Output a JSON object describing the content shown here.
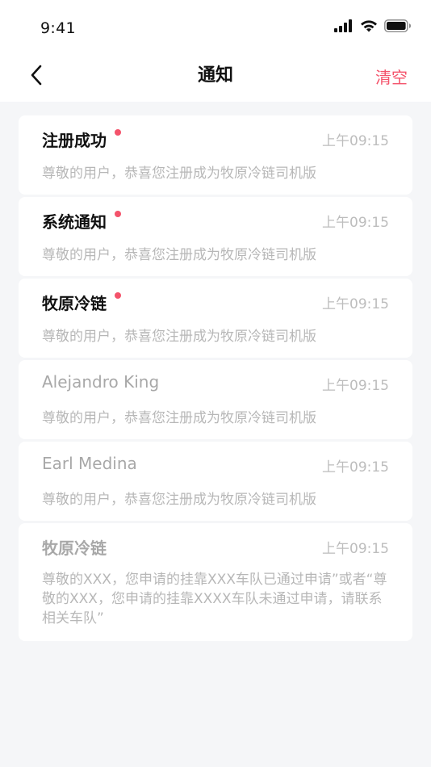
{
  "status_bar": {
    "time": "9:41",
    "icons": [
      "signal-icon",
      "wifi-icon",
      "battery-icon"
    ]
  },
  "nav": {
    "title": "通知",
    "action_label": "清空"
  },
  "notifications": [
    {
      "title": "注册成功",
      "time": "上午09:15",
      "body": "尊敬的用户，恭喜您注册成为牧原冷链司机版",
      "unread": true
    },
    {
      "title": "系统通知",
      "time": "上午09:15",
      "body": "尊敬的用户，恭喜您注册成为牧原冷链司机版",
      "unread": true
    },
    {
      "title": "牧原冷链",
      "time": "上午09:15",
      "body": "尊敬的用户，恭喜您注册成为牧原冷链司机版",
      "unread": true
    },
    {
      "title": "Alejandro King",
      "time": "上午09:15",
      "body": "尊敬的用户，恭喜您注册成为牧原冷链司机版",
      "unread": false
    },
    {
      "title": "Earl Medina",
      "time": "上午09:15",
      "body": "尊敬的用户，恭喜您注册成为牧原冷链司机版",
      "unread": false
    },
    {
      "title": "牧原冷链",
      "time": "上午09:15",
      "body": "尊敬的XXX，您申请的挂靠XXX车队已通过申请”或者“尊敬的XXX，您申请的挂靠XXXX车队未通过申请，请联系相关车队”",
      "unread": false
    }
  ],
  "colors": {
    "accent": "#f4536b",
    "background": "#f5f6f8",
    "card": "#ffffff",
    "muted_text": "#b7b7b7"
  }
}
